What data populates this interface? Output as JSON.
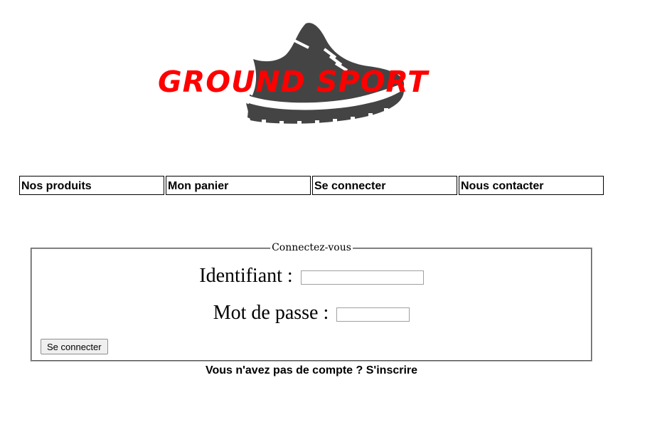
{
  "brand": {
    "name": "GROUND SPORT",
    "text_color": "#ff0000",
    "logo_icon": "sneaker-icon",
    "logo_icon_color": "#444444"
  },
  "nav": {
    "items": [
      {
        "label": "Nos produits"
      },
      {
        "label": "Mon panier"
      },
      {
        "label": "Se connecter"
      },
      {
        "label": "Nous contacter"
      }
    ]
  },
  "login": {
    "legend": "Connectez-vous",
    "username_label": "Identifiant :",
    "username_value": "",
    "password_label": "Mot de passe :",
    "password_value": "",
    "submit_label": "Se connecter"
  },
  "register": {
    "prompt": "Vous n'avez pas de compte ?",
    "link_label": "S'inscrire"
  }
}
